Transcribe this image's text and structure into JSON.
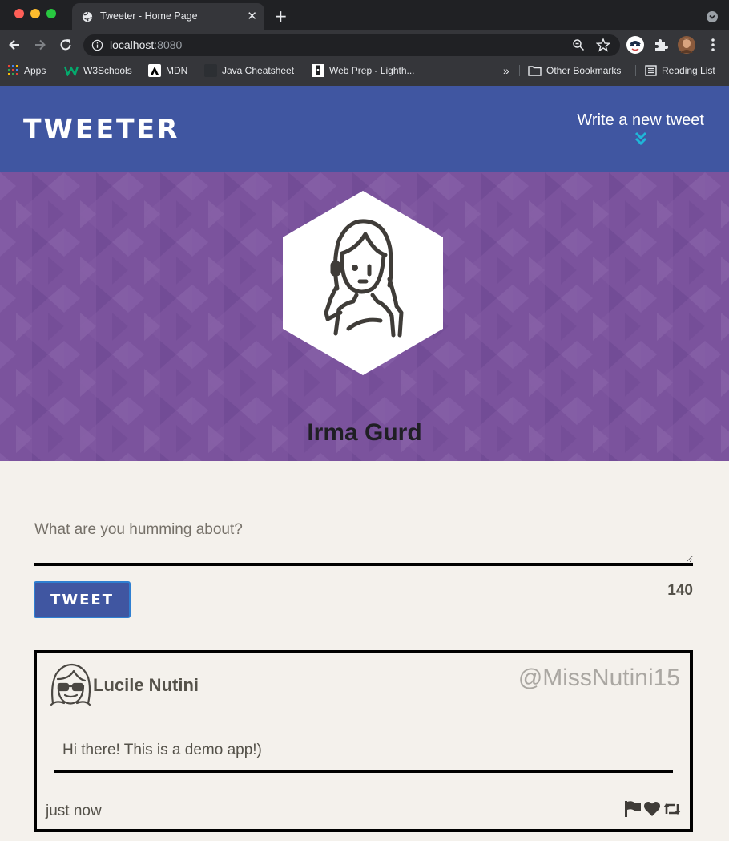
{
  "browser": {
    "tab_title": "Tweeter - Home Page",
    "tab_close": "✕",
    "new_tab": "+",
    "url_host": "localhost",
    "url_port": ":8080",
    "bookmarks": [
      {
        "label": "Apps",
        "icon": "apps-grid-icon"
      },
      {
        "label": "W3Schools",
        "icon": "w3schools-icon"
      },
      {
        "label": "MDN",
        "icon": "mdn-icon"
      },
      {
        "label": "Java Cheatsheet",
        "icon": "java-cheatsheet-icon"
      },
      {
        "label": "Web Prep - Lighth...",
        "icon": "lighthouse-icon"
      }
    ],
    "overflow": "»",
    "other_bookmarks": "Other Bookmarks",
    "reading_list": "Reading List"
  },
  "nav": {
    "brand": "TWEETER",
    "write_label": "Write a new tweet"
  },
  "profile": {
    "name": "Irma Gurd"
  },
  "composer": {
    "placeholder": "What are you humming about?",
    "button_label": "TWEET",
    "counter": "140"
  },
  "tweet": {
    "name": "Lucile Nutini",
    "handle": "@MissNutini15",
    "text": "Hi there! This is a demo app!)",
    "time": "just now",
    "actions": [
      "flag-icon",
      "heart-icon",
      "retweet-icon"
    ]
  },
  "colors": {
    "nav_bg": "#4056a1",
    "header_bg": "#7b539d",
    "page_bg": "#f4f1ec",
    "accent_chevron": "#1fb7d8",
    "text": "#545149",
    "handle": "#aaa7a2"
  }
}
